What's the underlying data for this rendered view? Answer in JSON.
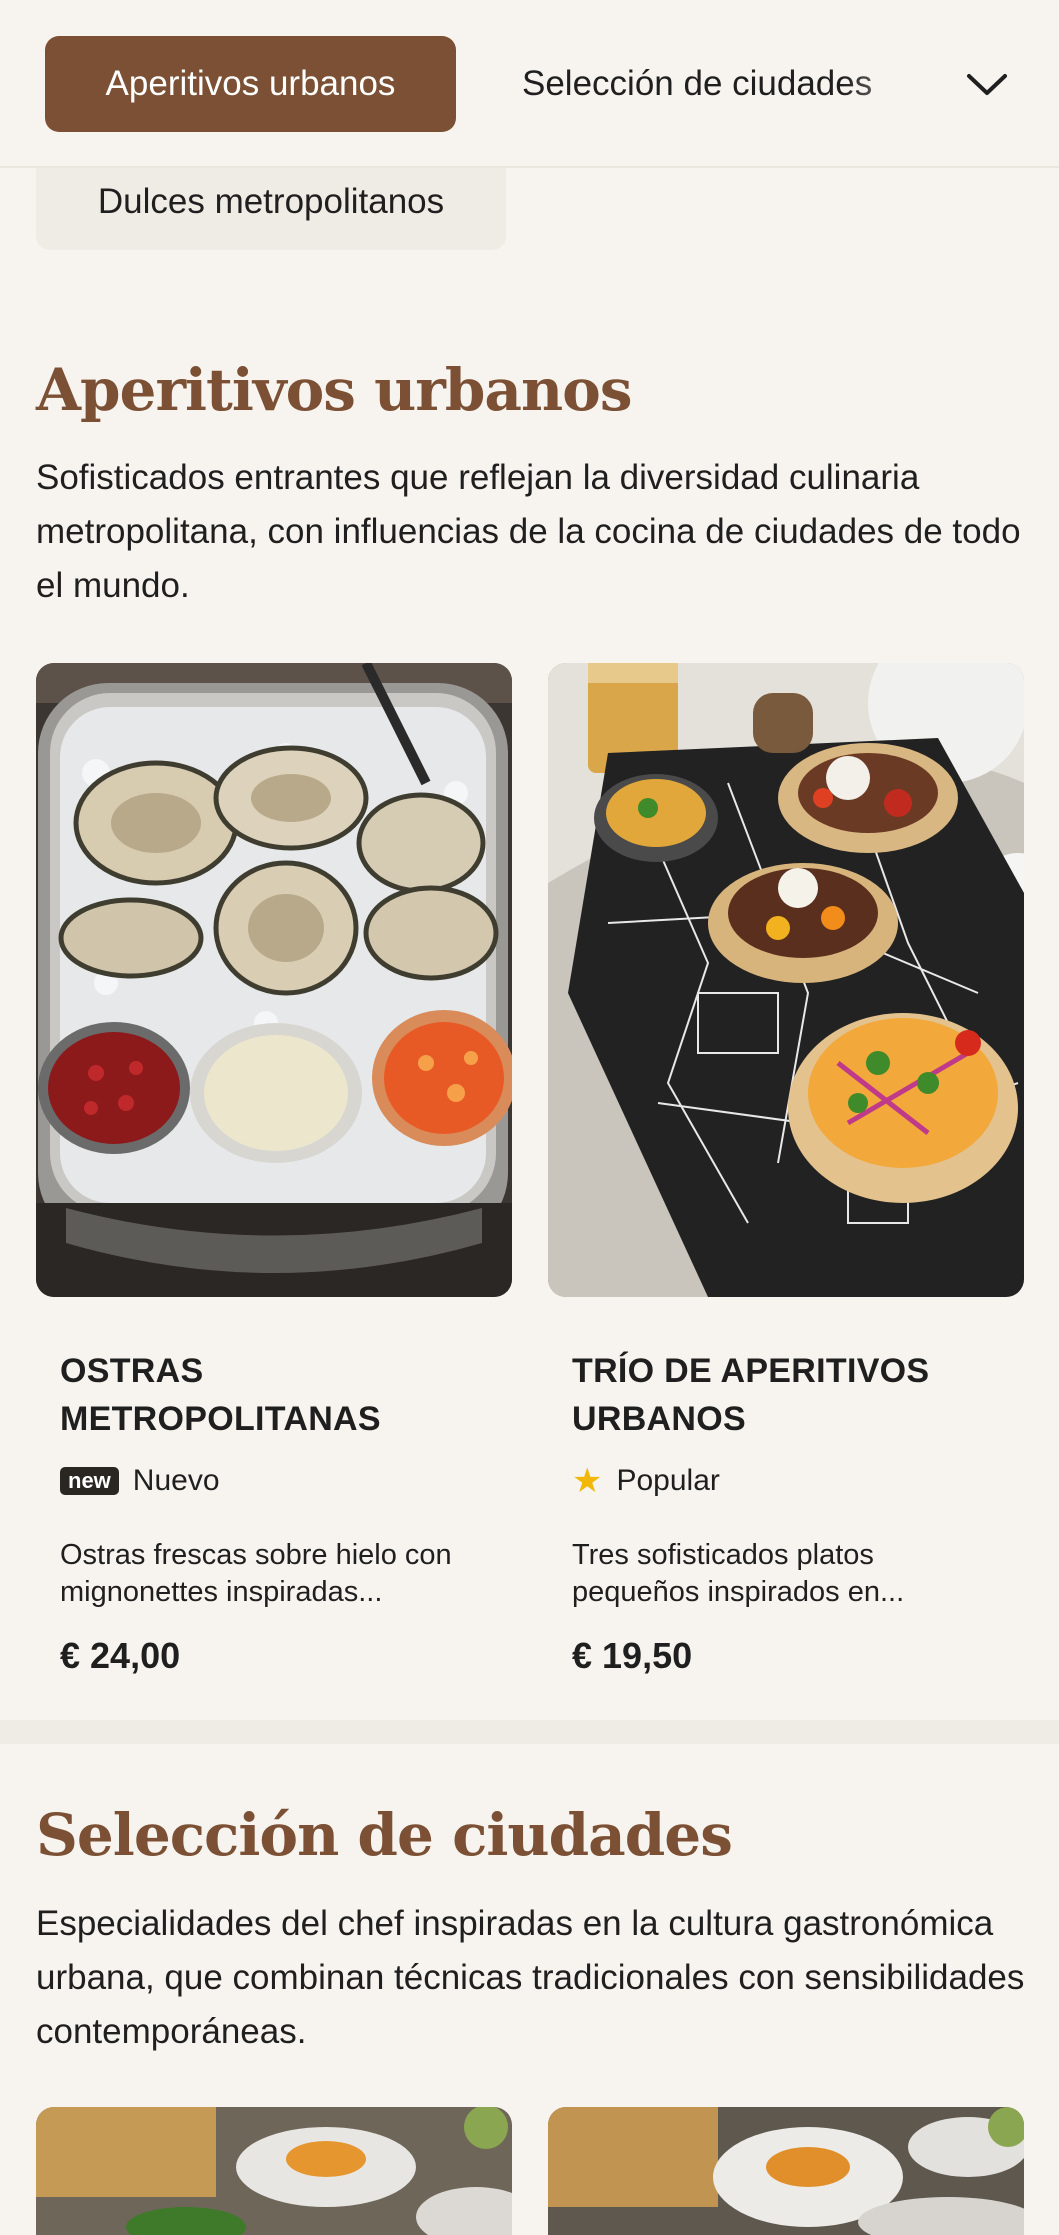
{
  "category_nav": {
    "active_tab": "Aperitivos urbanos",
    "next_tab": "Selección de ciudades",
    "overflow_tab": "Dulces metropolitanos",
    "expand_icon": "chevron-down-icon"
  },
  "sections": [
    {
      "title": "Aperitivos urbanos",
      "description": "Sofisticados entrantes que reflejan la diversidad culinaria metropolitana, con influencias de la cocina de ciudades de todo el mundo.",
      "items": [
        {
          "name": "OSTRAS METROPOLITANAS",
          "badge_tag": "new",
          "badge_label": "Nuevo",
          "description": "Ostras frescas sobre hielo con mignonettes inspiradas...",
          "price": "€ 24,00"
        },
        {
          "name": "TRÍO DE APERITIVOS URBANOS",
          "badge_icon": "star-icon",
          "badge_label": "Popular",
          "description": "Tres sofisticados platos pequeños inspirados en...",
          "price": "€ 19,50"
        }
      ]
    },
    {
      "title": "Selección de ciudades",
      "description": "Especialidades del chef inspiradas en la cultura gastronómica urbana, que combinan técnicas tradicionales con sensibilidades contemporáneas."
    }
  ],
  "colors": {
    "accent": "#7b5034",
    "background": "#f7f4ef",
    "star": "#f2b807"
  }
}
